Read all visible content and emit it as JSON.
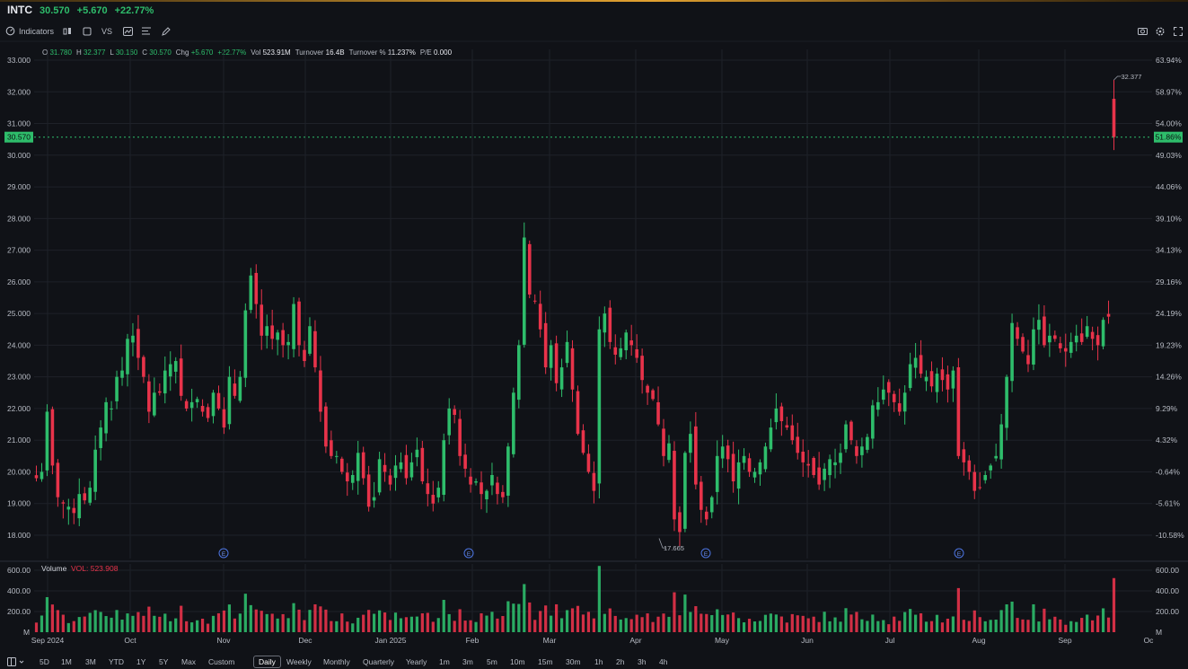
{
  "header": {
    "symbol": "INTC",
    "price": "30.570",
    "change": "+5.670",
    "change_pct": "+22.77%"
  },
  "toolbar": {
    "indicators_label": "Indicators",
    "compare_label": "VS",
    "icons": [
      "chart-type-icon",
      "square-icon",
      "compare-icon",
      "chart-style-icon",
      "list-icon",
      "draw-pen-icon",
      "camera-icon",
      "settings-icon",
      "fullscreen-icon"
    ]
  },
  "ohlc": {
    "o_label": "O",
    "o": "31.780",
    "h_label": "H",
    "h": "32.377",
    "l_label": "L",
    "l": "30.160",
    "c_label": "C",
    "c": "30.570",
    "chg_label": "Chg",
    "chg": "+5.670",
    "chg_pct": "+22.77%",
    "vol_label": "Vol",
    "vol": "523.91M",
    "turnover_label": "Turnover",
    "turnover": "16.4B",
    "turnover_pct_label": "Turnover %",
    "turnover_pct": "11.237%",
    "pe_label": "P/E",
    "pe": "0.000"
  },
  "volume_panel": {
    "title": "Volume",
    "value_label": "VOL: 523.908",
    "left_ticks": [
      "600.00",
      "400.00",
      "200.00",
      "M"
    ],
    "right_ticks": [
      "600.00",
      "400.00",
      "200.00",
      "M"
    ]
  },
  "chart_data": {
    "type": "candlestick",
    "price_ticks_left": [
      "33.000",
      "32.000",
      "31.000",
      "30.000",
      "29.000",
      "28.000",
      "27.000",
      "26.000",
      "25.000",
      "24.000",
      "23.000",
      "22.000",
      "21.000",
      "20.000",
      "19.000",
      "18.000"
    ],
    "pct_ticks_right": [
      "63.94%",
      "58.97%",
      "54.00%",
      "49.03%",
      "44.06%",
      "39.10%",
      "34.13%",
      "29.16%",
      "24.19%",
      "19.23%",
      "14.26%",
      "9.29%",
      "4.32%",
      "-0.64%",
      "-5.61%",
      "-10.58%"
    ],
    "ylim": [
      17.5,
      33.1
    ],
    "last_price_tag": "30.570",
    "last_pct_tag": "51.86%",
    "high_annotation": "32.377",
    "low_annotation": "17.665",
    "earnings_marker_label": "E",
    "x_month_labels": [
      "Sep 2024",
      "Oct",
      "Nov",
      "Dec",
      "Jan 2025",
      "Feb",
      "Mar",
      "Apr",
      "May",
      "Jun",
      "Jul",
      "Aug",
      "Sep",
      "Oc"
    ],
    "closes": [
      19.8,
      20.0,
      21.9,
      20.2,
      19.2,
      19.0,
      18.9,
      18.7,
      19.3,
      19.1,
      19.5,
      20.7,
      21.4,
      22.2,
      22.0,
      23.0,
      23.2,
      24.2,
      24.3,
      23.6,
      23.0,
      21.9,
      22.5,
      22.5,
      23.2,
      23.4,
      23.5,
      22.4,
      22.0,
      22.2,
      22.3,
      21.9,
      21.7,
      22.5,
      22.0,
      21.4,
      23.0,
      22.4,
      23.0,
      25.1,
      26.2,
      25.3,
      24.3,
      24.6,
      24.2,
      24.4,
      24.0,
      24.1,
      25.3,
      24.0,
      23.5,
      24.6,
      23.3,
      21.9,
      20.8,
      20.5,
      20.5,
      20.0,
      19.7,
      19.9,
      20.6,
      19.8,
      18.9,
      19.2,
      20.4,
      20.0,
      19.6,
      20.2,
      20.3,
      19.8,
      20.3,
      20.7,
      19.7,
      19.3,
      19.0,
      19.5,
      21.0,
      22.0,
      21.8,
      20.5,
      20.1,
      19.6,
      19.7,
      19.3,
      19.4,
      19.9,
      19.3,
      19.2,
      20.8,
      22.5,
      24.0,
      27.4,
      25.6,
      25.4,
      24.5,
      23.3,
      24.0,
      22.8,
      23.3,
      24.1,
      22.6,
      21.2,
      20.6,
      20.0,
      19.4,
      24.5,
      25.0,
      24.1,
      23.7,
      23.9,
      24.4,
      24.0,
      23.6,
      22.9,
      22.5,
      22.3,
      21.5,
      20.5,
      20.9,
      18.5,
      18.1,
      20.6,
      21.2,
      19.6,
      18.8,
      18.5,
      19.2,
      20.5,
      20.8,
      20.4,
      19.7,
      20.3,
      20.5,
      20.0,
      20.0,
      20.3,
      20.8,
      21.4,
      22.0,
      21.6,
      21.4,
      21.0,
      20.6,
      20.3,
      20.2,
      19.9,
      19.6,
      20.1,
      20.4,
      20.3,
      20.6,
      21.5,
      21.0,
      20.5,
      20.8,
      21.1,
      22.1,
      22.2,
      22.6,
      22.5,
      22.2,
      21.9,
      22.5,
      23.4,
      23.6,
      23.1,
      23.0,
      22.7,
      23.1,
      22.9,
      22.6,
      23.2,
      20.5,
      20.3,
      20.0,
      19.4,
      19.5,
      19.9,
      20.2,
      20.5,
      21.5,
      23.0,
      24.7,
      24.2,
      23.8,
      23.4,
      24.5,
      24.8,
      24.0,
      24.3,
      24.2,
      23.9,
      23.8,
      24.1,
      24.3,
      24.1,
      24.6,
      24.2,
      24.0,
      24.8,
      24.9,
      30.57
    ],
    "volume_note": "Daily volume bars (M), red = down day, green = up day; final bar 523.908M"
  },
  "bottom_bar": {
    "ranges": [
      "5D",
      "1M",
      "3M",
      "YTD",
      "1Y",
      "5Y",
      "Max",
      "Custom"
    ],
    "intervals": [
      "Daily",
      "Weekly",
      "Monthly",
      "Quarterly",
      "Yearly",
      "1m",
      "3m",
      "5m",
      "10m",
      "15m",
      "30m",
      "1h",
      "2h",
      "3h",
      "4h"
    ],
    "active_interval": "Daily"
  },
  "colors": {
    "background": "#101217",
    "up": "#2ebd6b",
    "down": "#e8334a",
    "grid": "#1e2129",
    "axis_text": "#b8bcc5",
    "tag_green": "#2ebd6b"
  }
}
